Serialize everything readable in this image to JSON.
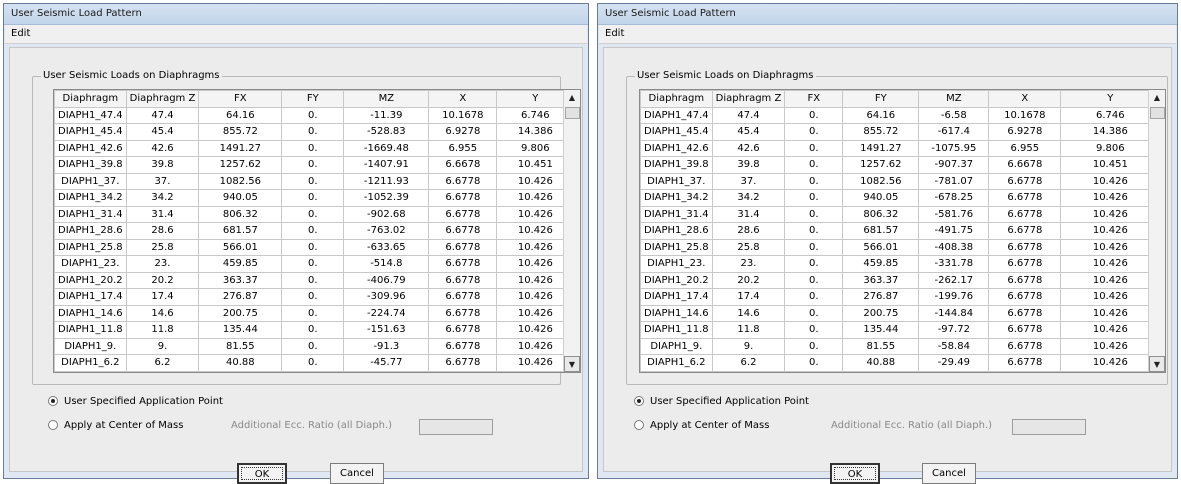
{
  "dialogs": [
    {
      "title": "User Seismic Load Pattern",
      "menu": "Edit",
      "group_title": "User Seismic Loads on Diaphragms",
      "columns": [
        "Diaphragm",
        "Diaphragm Z",
        "FX",
        "FY",
        "MZ",
        "X",
        "Y"
      ],
      "rows": [
        [
          "DIAPH1_47.4",
          "47.4",
          "64.16",
          "0.",
          "-11.39",
          "10.1678",
          "6.746"
        ],
        [
          "DIAPH1_45.4",
          "45.4",
          "855.72",
          "0.",
          "-528.83",
          "6.9278",
          "14.386"
        ],
        [
          "DIAPH1_42.6",
          "42.6",
          "1491.27",
          "0.",
          "-1669.48",
          "6.955",
          "9.806"
        ],
        [
          "DIAPH1_39.8",
          "39.8",
          "1257.62",
          "0.",
          "-1407.91",
          "6.6678",
          "10.451"
        ],
        [
          "DIAPH1_37.",
          "37.",
          "1082.56",
          "0.",
          "-1211.93",
          "6.6778",
          "10.426"
        ],
        [
          "DIAPH1_34.2",
          "34.2",
          "940.05",
          "0.",
          "-1052.39",
          "6.6778",
          "10.426"
        ],
        [
          "DIAPH1_31.4",
          "31.4",
          "806.32",
          "0.",
          "-902.68",
          "6.6778",
          "10.426"
        ],
        [
          "DIAPH1_28.6",
          "28.6",
          "681.57",
          "0.",
          "-763.02",
          "6.6778",
          "10.426"
        ],
        [
          "DIAPH1_25.8",
          "25.8",
          "566.01",
          "0.",
          "-633.65",
          "6.6778",
          "10.426"
        ],
        [
          "DIAPH1_23.",
          "23.",
          "459.85",
          "0.",
          "-514.8",
          "6.6778",
          "10.426"
        ],
        [
          "DIAPH1_20.2",
          "20.2",
          "363.37",
          "0.",
          "-406.79",
          "6.6778",
          "10.426"
        ],
        [
          "DIAPH1_17.4",
          "17.4",
          "276.87",
          "0.",
          "-309.96",
          "6.6778",
          "10.426"
        ],
        [
          "DIAPH1_14.6",
          "14.6",
          "200.75",
          "0.",
          "-224.74",
          "6.6778",
          "10.426"
        ],
        [
          "DIAPH1_11.8",
          "11.8",
          "135.44",
          "0.",
          "-151.63",
          "6.6778",
          "10.426"
        ],
        [
          "DIAPH1_9.",
          "9.",
          "81.55",
          "0.",
          "-91.3",
          "6.6778",
          "10.426"
        ],
        [
          "DIAPH1_6.2",
          "6.2",
          "40.88",
          "0.",
          "-45.77",
          "6.6778",
          "10.426"
        ]
      ],
      "radio_user": "User Specified Application Point",
      "radio_mass": "Apply at Center of Mass",
      "ecc_label": "Additional Ecc. Ratio (all Diaph.)",
      "ok": "OK",
      "cancel": "Cancel"
    },
    {
      "title": "User Seismic Load Pattern",
      "menu": "Edit",
      "group_title": "User Seismic Loads on Diaphragms",
      "columns": [
        "Diaphragm",
        "Diaphragm Z",
        "FX",
        "FY",
        "MZ",
        "X",
        "Y"
      ],
      "rows": [
        [
          "DIAPH1_47.4",
          "47.4",
          "0.",
          "64.16",
          "-6.58",
          "10.1678",
          "6.746"
        ],
        [
          "DIAPH1_45.4",
          "45.4",
          "0.",
          "855.72",
          "-617.4",
          "6.9278",
          "14.386"
        ],
        [
          "DIAPH1_42.6",
          "42.6",
          "0.",
          "1491.27",
          "-1075.95",
          "6.955",
          "9.806"
        ],
        [
          "DIAPH1_39.8",
          "39.8",
          "0.",
          "1257.62",
          "-907.37",
          "6.6678",
          "10.451"
        ],
        [
          "DIAPH1_37.",
          "37.",
          "0.",
          "1082.56",
          "-781.07",
          "6.6778",
          "10.426"
        ],
        [
          "DIAPH1_34.2",
          "34.2",
          "0.",
          "940.05",
          "-678.25",
          "6.6778",
          "10.426"
        ],
        [
          "DIAPH1_31.4",
          "31.4",
          "0.",
          "806.32",
          "-581.76",
          "6.6778",
          "10.426"
        ],
        [
          "DIAPH1_28.6",
          "28.6",
          "0.",
          "681.57",
          "-491.75",
          "6.6778",
          "10.426"
        ],
        [
          "DIAPH1_25.8",
          "25.8",
          "0.",
          "566.01",
          "-408.38",
          "6.6778",
          "10.426"
        ],
        [
          "DIAPH1_23.",
          "23.",
          "0.",
          "459.85",
          "-331.78",
          "6.6778",
          "10.426"
        ],
        [
          "DIAPH1_20.2",
          "20.2",
          "0.",
          "363.37",
          "-262.17",
          "6.6778",
          "10.426"
        ],
        [
          "DIAPH1_17.4",
          "17.4",
          "0.",
          "276.87",
          "-199.76",
          "6.6778",
          "10.426"
        ],
        [
          "DIAPH1_14.6",
          "14.6",
          "0.",
          "200.75",
          "-144.84",
          "6.6778",
          "10.426"
        ],
        [
          "DIAPH1_11.8",
          "11.8",
          "0.",
          "135.44",
          "-97.72",
          "6.6778",
          "10.426"
        ],
        [
          "DIAPH1_9.",
          "9.",
          "0.",
          "81.55",
          "-58.84",
          "6.6778",
          "10.426"
        ],
        [
          "DIAPH1_6.2",
          "6.2",
          "0.",
          "40.88",
          "-29.49",
          "6.6778",
          "10.426"
        ]
      ],
      "radio_user": "User Specified Application Point",
      "radio_mass": "Apply at Center of Mass",
      "ecc_label": "Additional Ecc. Ratio (all Diaph.)",
      "ok": "OK",
      "cancel": "Cancel"
    }
  ],
  "icons": {
    "scroll_up": "scroll-up-arrow-icon",
    "scroll_down": "scroll-down-arrow-icon"
  }
}
